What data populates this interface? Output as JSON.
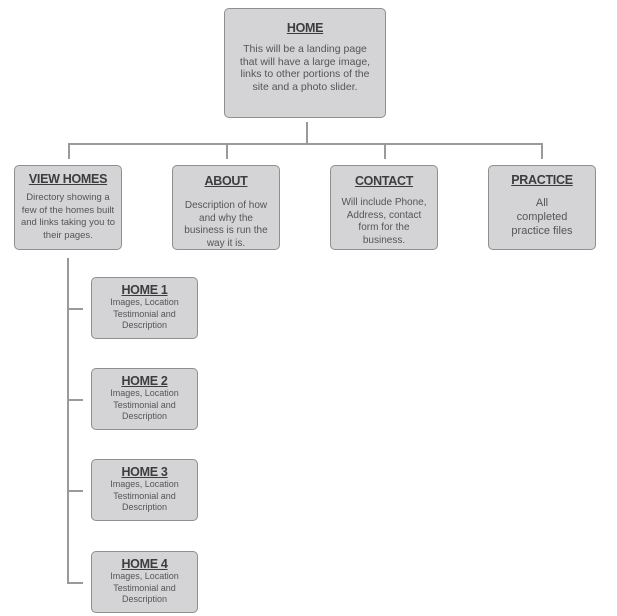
{
  "root": {
    "title": "HOME",
    "description": "This will be a landing page that will have a large image, links to other portions of the site and a photo slider."
  },
  "sections": [
    {
      "title": "VIEW HOMES",
      "description": "Directory showing a few of the homes built and links taking you to their pages."
    },
    {
      "title": "ABOUT",
      "description": "Description of how and why the business is run the way it is."
    },
    {
      "title": "CONTACT",
      "description": "Will include Phone, Address, contact form for the business."
    },
    {
      "title": "PRACTICE",
      "description": "All completed practice files"
    }
  ],
  "homes": [
    {
      "title": "HOME 1",
      "description": "Images, Location Testimonial and Description"
    },
    {
      "title": "HOME 2",
      "description": "Images, Location Testimonial and Description"
    },
    {
      "title": "HOME 3",
      "description": "Images, Location Testimonial and Description"
    },
    {
      "title": "HOME 4",
      "description": "Images, Location Testimonial and Description"
    }
  ]
}
